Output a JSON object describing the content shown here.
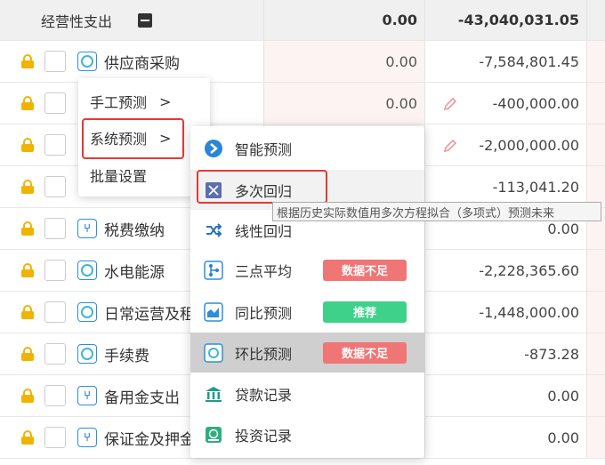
{
  "header": {
    "title": "经营性支出",
    "v1": "0.00",
    "v2": "-43,040,031.05"
  },
  "rows": [
    {
      "name": "供应商采购",
      "v1": "0.00",
      "v2": "-7,584,801.45",
      "icon": "ring-icon"
    },
    {
      "name": "",
      "v1": "0.00",
      "v2": "-400,000.00",
      "icon": "branch-icon"
    },
    {
      "name": "",
      "v1": "",
      "v2": "-2,000,000.00",
      "icon": "branch-icon"
    },
    {
      "name": "",
      "v1": "",
      "v2": "-113,041.20",
      "icon": "branch-icon"
    },
    {
      "name": "税费缴纳",
      "v1": "",
      "v2": "0.00",
      "icon": "branch-icon"
    },
    {
      "name": "水电能源",
      "v1": "",
      "v2": "-2,228,365.60",
      "icon": "ring-icon"
    },
    {
      "name": "日常运营及租",
      "v1": "",
      "v2": "-1,448,000.00",
      "icon": "ring-icon"
    },
    {
      "name": "手续费",
      "v1": "",
      "v2": "-873.28",
      "icon": "ring-icon"
    },
    {
      "name": "备用金支出",
      "v1": "",
      "v2": "0.00",
      "icon": "branch-icon"
    },
    {
      "name": "保证金及押金",
      "v1": "",
      "v2": "0.00",
      "icon": "branch-icon"
    }
  ],
  "context_menu": {
    "items": [
      {
        "label": "手工预测",
        "arrow": ">"
      },
      {
        "label": "系统预测",
        "arrow": ">"
      },
      {
        "label": "批量设置",
        "arrow": ""
      }
    ]
  },
  "submenu": {
    "items": [
      {
        "label": "智能预测",
        "icon": "smart-forecast-icon",
        "badge": ""
      },
      {
        "label": "多次回归",
        "icon": "expand-arrows-icon",
        "badge": ""
      },
      {
        "label": "线性回归",
        "icon": "shuffle-icon",
        "badge": ""
      },
      {
        "label": "三点平均",
        "icon": "branch-icon",
        "badge": "数据不足"
      },
      {
        "label": "同比预测",
        "icon": "area-chart-icon",
        "badge": "推荐"
      },
      {
        "label": "环比预测",
        "icon": "ring-icon",
        "badge": "数据不足"
      },
      {
        "label": "贷款记录",
        "icon": "bank-icon",
        "badge": ""
      },
      {
        "label": "投资记录",
        "icon": "money-icon",
        "badge": ""
      }
    ]
  },
  "tooltip": "根据历史实际数值用多次方程拟合（多项式）预测未来",
  "colors": {
    "badge_insufficient": "#f07575",
    "badge_recommend": "#3dd18a",
    "highlight": "#e53935",
    "lock": "#f0b400",
    "accent": "#2c8fd8"
  }
}
